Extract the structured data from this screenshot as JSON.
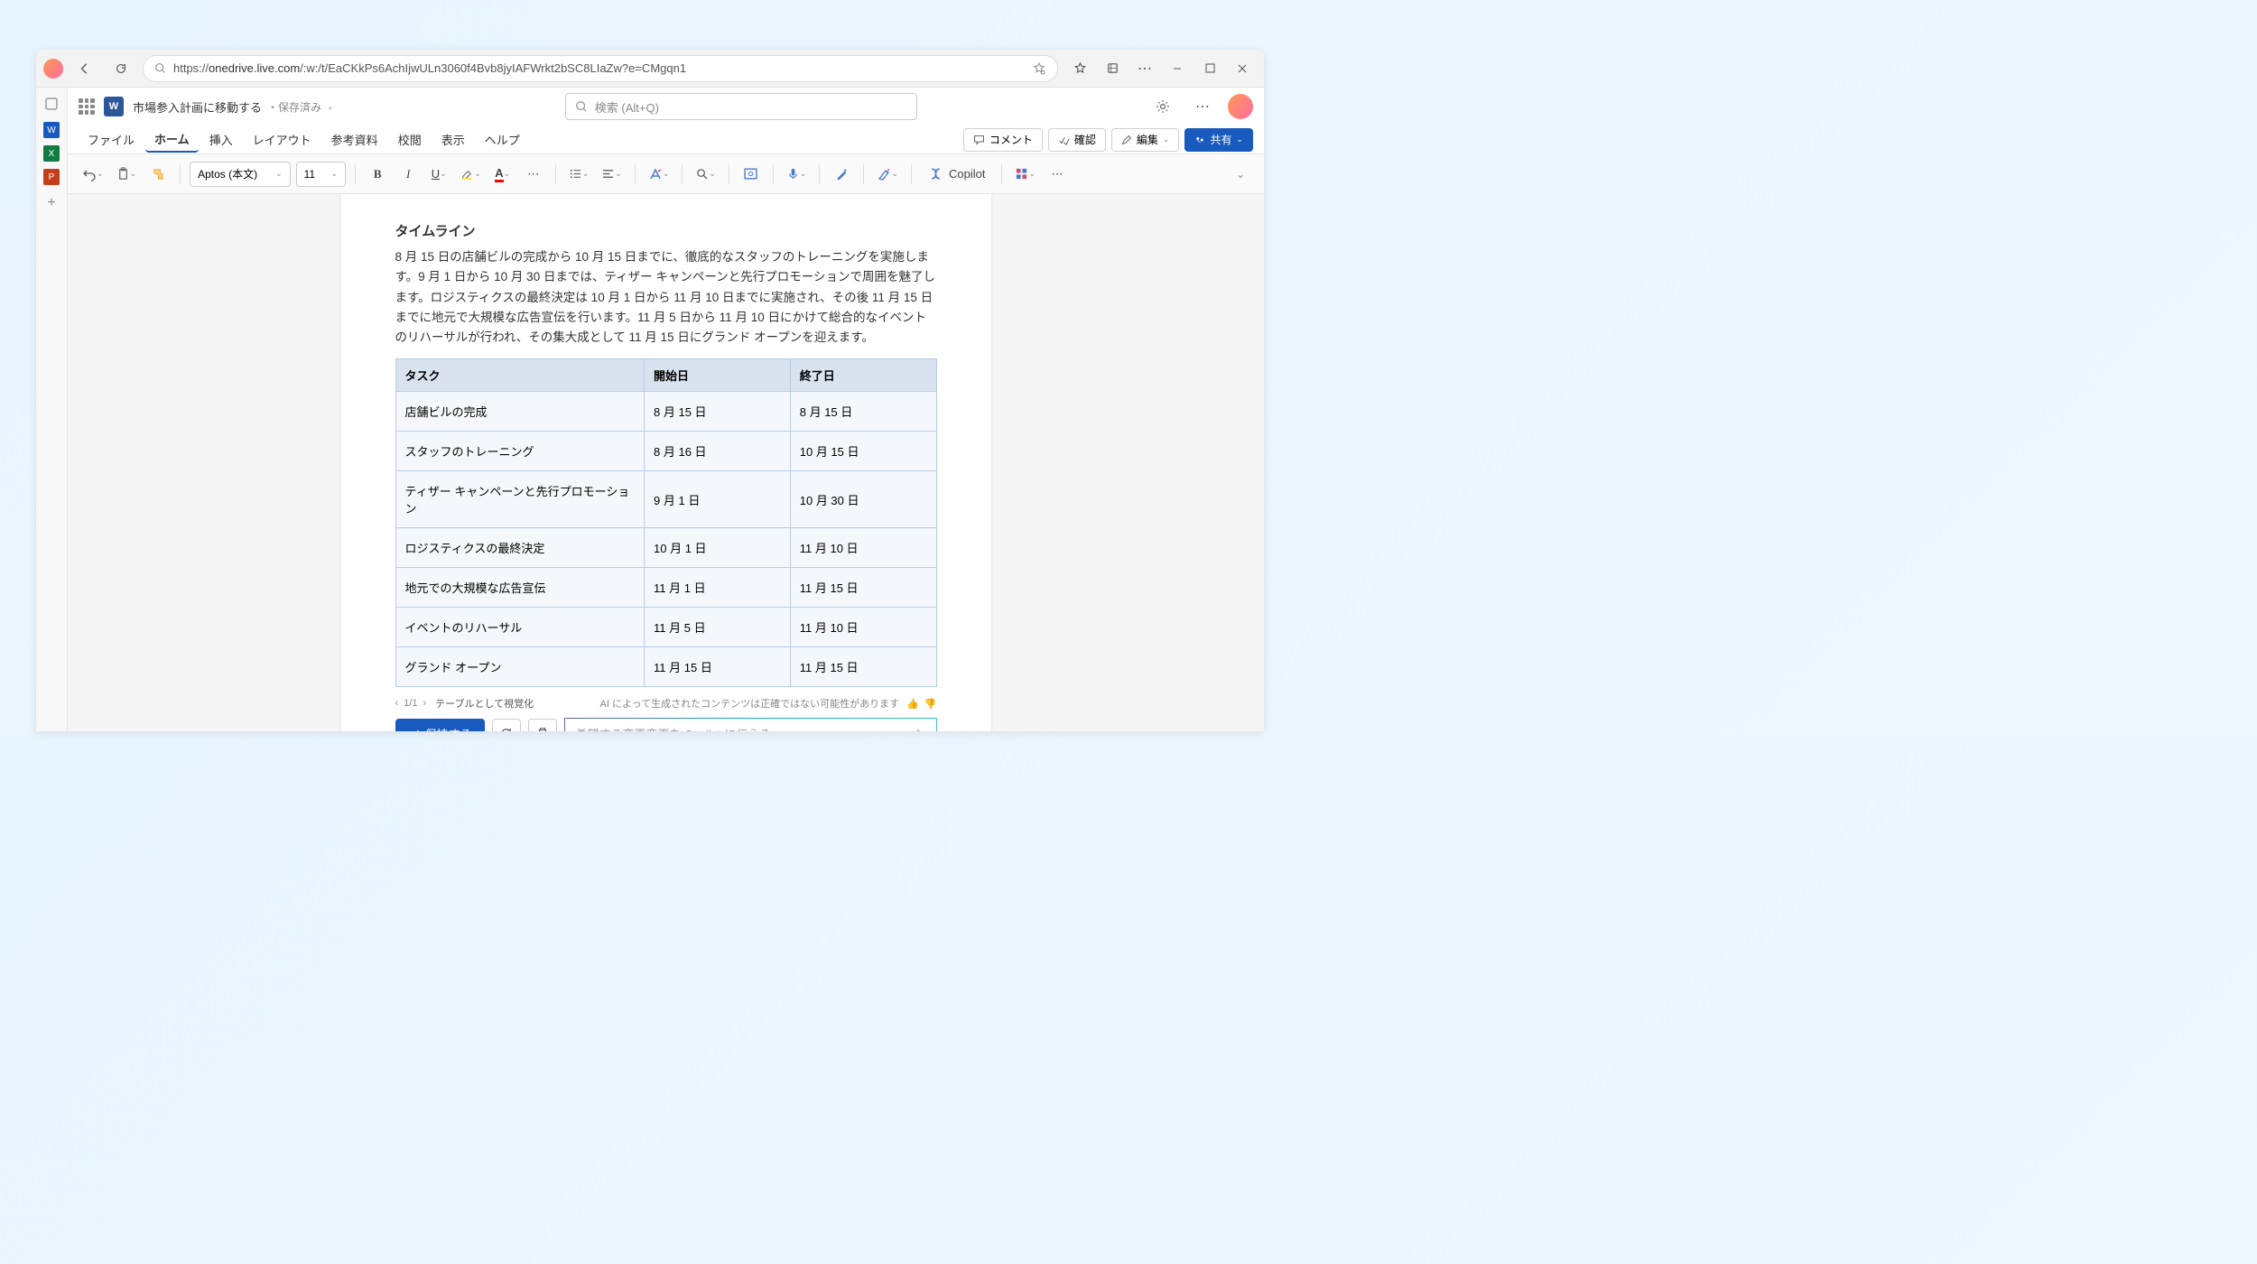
{
  "browser": {
    "url_prefix": "https://",
    "url_host": "onedrive.live.com",
    "url_path": "/:w:/t/EaCKkPs6AchIjwULn3060f4Bvb8jyIAFWrkt2bSC8LIaZw?e=CMgqn1"
  },
  "titlebar": {
    "doc_name": "市場参入計画に移動する",
    "saved_status": "・保存済み",
    "search_placeholder": "検索 (Alt+Q)"
  },
  "menu": {
    "file": "ファイル",
    "home": "ホーム",
    "insert": "挿入",
    "layout": "レイアウト",
    "references": "参考資料",
    "review": "校閲",
    "view": "表示",
    "help": "ヘルプ",
    "comments": "コメント",
    "confirm": "確認",
    "edit": "編集",
    "share": "共有"
  },
  "ribbon": {
    "font_name": "Aptos (本文)",
    "font_size": "11",
    "copilot": "Copilot"
  },
  "document": {
    "heading": "タイムライン",
    "paragraph": "8 月 15 日の店舗ビルの完成から 10 月 15 日までに、徹底的なスタッフのトレーニングを実施します。9 月 1 日から 10 月 30 日までは、ティザー キャンペーンと先行プロモーションで周囲を魅了します。ロジスティクスの最終決定は 10 月 1 日から 11 月 10 日までに実施され、その後 11 月 15 日までに地元で大規模な広告宣伝を行います。11 月 5 日から 11 月 10 日にかけて総合的なイベントのリハーサルが行われ、その集大成として 11 月 15 日にグランド オープンを迎えます。",
    "table": {
      "headers": {
        "task": "タスク",
        "start": "開始日",
        "end": "終了日"
      },
      "rows": [
        {
          "task": "店舗ビルの完成",
          "start": "8 月 15 日",
          "end": "8 月 15 日"
        },
        {
          "task": "スタッフのトレーニング",
          "start": "8 月 16 日",
          "end": "10 月 15 日"
        },
        {
          "task": "ティザー キャンペーンと先行プロモーション",
          "start": "9 月 1 日",
          "end": "10 月 30 日"
        },
        {
          "task": "ロジスティクスの最終決定",
          "start": "10 月 1 日",
          "end": "11 月 10 日"
        },
        {
          "task": "地元での大規模な広告宣伝",
          "start": "11 月 1 日",
          "end": "11 月 15 日"
        },
        {
          "task": "イベントのリハーサル",
          "start": "11 月 5 日",
          "end": "11 月 10 日"
        },
        {
          "task": "グランド オープン",
          "start": "11 月 15 日",
          "end": "11 月 15 日"
        }
      ]
    }
  },
  "copilot_bar": {
    "page_indicator": "1/1",
    "visualize_label": "テーブルとして視覚化",
    "disclaimer": "AI によって生成されたコンテンツは正確ではない可能性があります",
    "keep_label": "保持する",
    "input_placeholder": "希望する変更変更を Copilot に伝える"
  }
}
